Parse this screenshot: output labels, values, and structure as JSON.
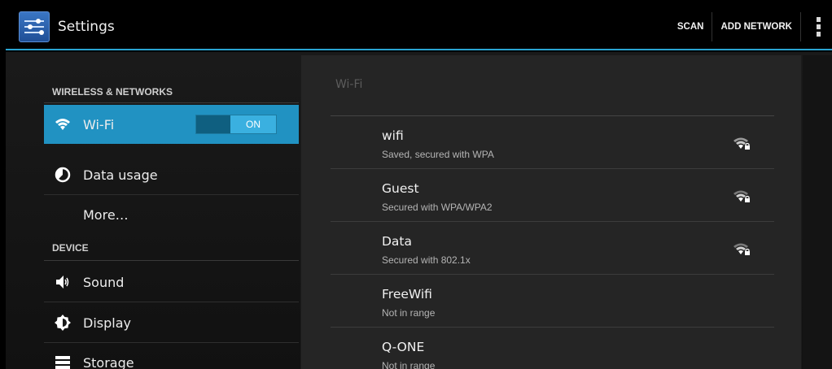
{
  "actionbar": {
    "title": "Settings",
    "actions": [
      "SCAN",
      "ADD NETWORK"
    ]
  },
  "sidebar": {
    "categories": [
      "WIRELESS & NETWORKS",
      "DEVICE"
    ],
    "items": [
      {
        "label": "Wi-Fi",
        "icon": "wifi-icon",
        "toggle": "ON",
        "selected": true
      },
      {
        "label": "Data usage",
        "icon": "data-usage-icon"
      },
      {
        "label": "More…",
        "icon": ""
      },
      {
        "label": "Sound",
        "icon": "speaker-icon"
      },
      {
        "label": "Display",
        "icon": "display-icon"
      },
      {
        "label": "Storage",
        "icon": "storage-icon"
      }
    ]
  },
  "wifi_pane": {
    "title": "Wi-Fi",
    "networks": [
      {
        "name": "wifi",
        "status": "Saved, secured with WPA",
        "signal": true
      },
      {
        "name": "Guest",
        "status": "Secured with WPA/WPA2",
        "signal": true
      },
      {
        "name": "Data",
        "status": "Secured with 802.1x",
        "signal": true
      },
      {
        "name": "FreeWifi",
        "status": "Not in range",
        "signal": false
      },
      {
        "name": "Q-ONE",
        "status": "Not in range",
        "signal": false
      }
    ]
  },
  "colors": {
    "accent": "#2192c2",
    "actionbar_line": "#2aa4d2"
  }
}
